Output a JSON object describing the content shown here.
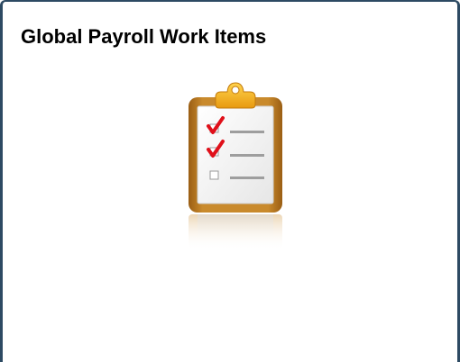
{
  "tile": {
    "title": "Global Payroll Work Items",
    "icon": "clipboard-checklist-icon"
  },
  "colors": {
    "frame_border": "#2d4a63",
    "background": "#ffffff",
    "clipboard_board": "#b9761f",
    "clipboard_clip": "#f2b11c",
    "paper": "#f4f4f4",
    "check_mark": "#e0101a",
    "line": "#9e9e9e"
  }
}
